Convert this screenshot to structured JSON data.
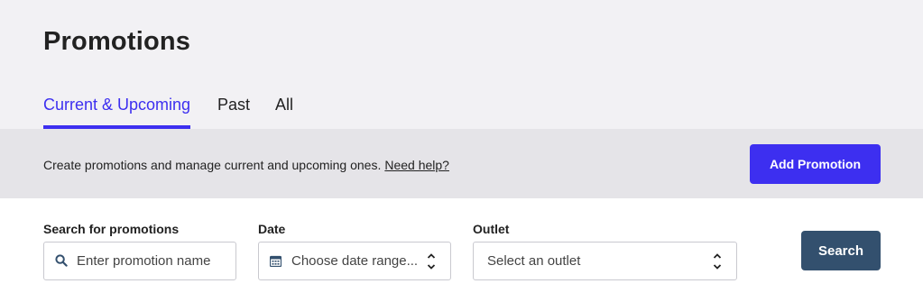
{
  "header": {
    "title": "Promotions",
    "tabs": [
      {
        "label": "Current & Upcoming",
        "active": true
      },
      {
        "label": "Past",
        "active": false
      },
      {
        "label": "All",
        "active": false
      }
    ]
  },
  "info_bar": {
    "text": "Create promotions and manage current and upcoming ones.",
    "help_link": "Need help?",
    "add_button": "Add Promotion"
  },
  "filters": {
    "search": {
      "label": "Search for promotions",
      "placeholder": "Enter promotion name",
      "icon": "search-icon"
    },
    "date": {
      "label": "Date",
      "placeholder": "Choose date range...",
      "icon": "calendar-icon"
    },
    "outlet": {
      "label": "Outlet",
      "placeholder": "Select an outlet"
    },
    "search_button": "Search"
  },
  "colors": {
    "accent": "#3d2ff0",
    "search_button": "#33506e",
    "header_bg": "#f2f1f4",
    "info_bg": "#e5e4e8"
  }
}
